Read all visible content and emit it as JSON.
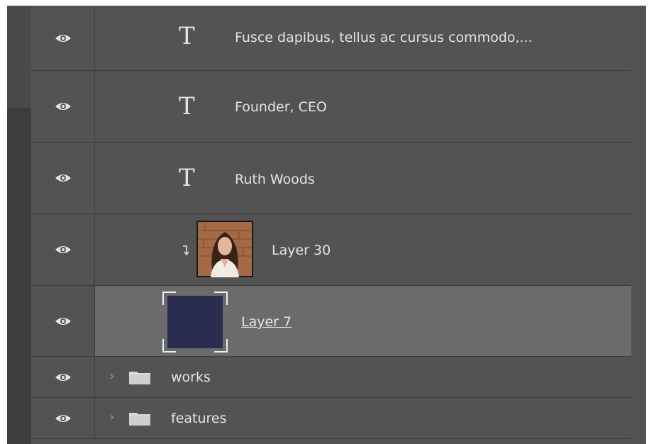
{
  "layers": [
    {
      "type": "text",
      "name": "Fusce dapibus, tellus ac cursus commodo,...",
      "visible": true
    },
    {
      "type": "text",
      "name": "Founder, CEO",
      "visible": true
    },
    {
      "type": "text",
      "name": "Ruth Woods",
      "visible": true
    },
    {
      "type": "image",
      "name": "Layer 30",
      "clipped": true,
      "visible": true
    },
    {
      "type": "shape",
      "name": "Layer 7",
      "selected": true,
      "fill": "#2a2d4f",
      "visible": true
    },
    {
      "type": "group",
      "name": "works",
      "collapsed": true,
      "visible": true
    },
    {
      "type": "group",
      "name": "features",
      "collapsed": true,
      "visible": true
    }
  ],
  "icons": {
    "visibility": "eye-icon",
    "text_layer": "T",
    "group": "folder-icon",
    "expand": "chevron-right-icon",
    "clipping": "clipping-mask-arrow-icon"
  },
  "colors": {
    "panel_bg": "#535353",
    "selected_row": "#6b6b6b",
    "text": "#e4e4e4"
  }
}
